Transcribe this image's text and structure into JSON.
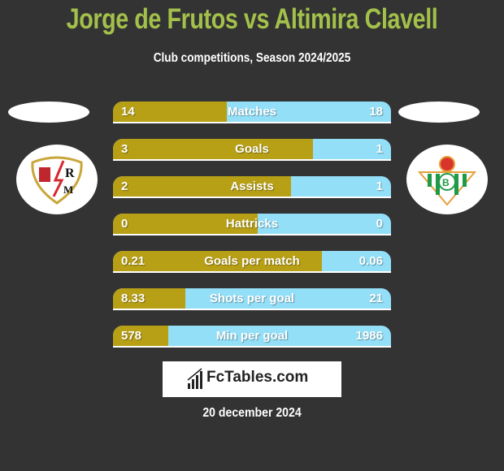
{
  "header": {
    "title": "Jorge de Frutos vs Altimira Clavell",
    "subtitle": "Club competitions, Season 2024/2025"
  },
  "players": {
    "left": {
      "name": "Jorge de Frutos",
      "club_logo": "rayo-vallecano-crest-icon"
    },
    "right": {
      "name": "Altimira Clavell",
      "club_logo": "real-betis-crest-icon"
    }
  },
  "colors": {
    "background": "#333333",
    "title": "#a3c14a",
    "left_bar": "#b8a016",
    "right_bar": "#93dff8"
  },
  "stats": [
    {
      "label": "Matches",
      "left": "14",
      "right": "18",
      "left_share": 0.41
    },
    {
      "label": "Goals",
      "left": "3",
      "right": "1",
      "left_share": 0.72
    },
    {
      "label": "Assists",
      "left": "2",
      "right": "1",
      "left_share": 0.64
    },
    {
      "label": "Hattricks",
      "left": "0",
      "right": "0",
      "left_share": 0.52
    },
    {
      "label": "Goals per match",
      "left": "0.21",
      "right": "0.06",
      "left_share": 0.75
    },
    {
      "label": "Shots per goal",
      "left": "8.33",
      "right": "21",
      "left_share": 0.26
    },
    {
      "label": "Min per goal",
      "left": "578",
      "right": "1986",
      "left_share": 0.2
    }
  ],
  "footer": {
    "brand": "FcTables.com",
    "date": "20 december 2024"
  }
}
